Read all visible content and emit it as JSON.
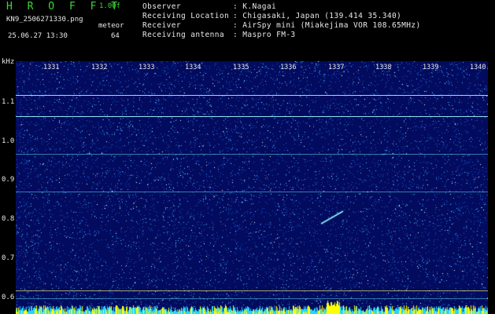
{
  "header": {
    "app_title": "H R O F F T",
    "version": "1.00f",
    "filename": "KN9_2506271330.png",
    "label_meteor": "meteor",
    "meteor_count": "64",
    "datetime": "25.06.27 13:30"
  },
  "info": [
    {
      "key": "Observer",
      "value": ": K.Nagai"
    },
    {
      "key": "Receiving Location",
      "value": ": Chigasaki, Japan (139.414 35.340)"
    },
    {
      "key": "Receiver",
      "value": ": AirSpy mini (Miakejima VOR 108.65MHz)"
    },
    {
      "key": "Receiving antenna",
      "value": ": Maspro FM-3"
    }
  ],
  "spectrogram": {
    "y_unit": "kHz",
    "y_ticks": [
      "1.1",
      "1.0",
      "0.9",
      "0.8",
      "0.7",
      "0.6"
    ],
    "x_ticks": [
      "1331",
      "1332",
      "1333",
      "1334",
      "1335",
      "1336",
      "1337",
      "1338",
      "1339",
      "1340"
    ],
    "colors": {
      "background": "#030b5e",
      "signal": "#9ef7ff",
      "noise_bar": "#ffff00"
    }
  }
}
